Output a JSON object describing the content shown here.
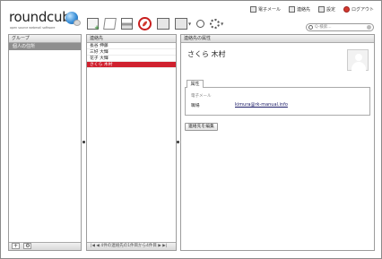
{
  "app": {
    "logo_text": "roundcube",
    "logo_tagline": "open source webmail software"
  },
  "topnav": {
    "mail": "電子メール",
    "contacts": "連絡先",
    "settings": "設定",
    "logout": "ログアウト"
  },
  "search": {
    "placeholder": "Q-検索..."
  },
  "groups": {
    "header": "グループ",
    "items": [
      {
        "label": "個人の住所",
        "selected": true
      }
    ]
  },
  "contacts": {
    "header": "連絡先",
    "rows": [
      {
        "name": "長谷 伸藤",
        "selected": false
      },
      {
        "name": "三好 大輝",
        "selected": false
      },
      {
        "name": "花子 大輝",
        "selected": false
      },
      {
        "name": "さくら 木村",
        "selected": true
      }
    ],
    "pager": "4件の連絡先の1件目から4件目"
  },
  "detail": {
    "header": "連絡先の属性",
    "name": "さくら 木村",
    "tab": "属性",
    "section_label": "電子メール",
    "field_label": "職場",
    "email": "kimura@rk-manual.info",
    "edit_button": "連絡先を編集"
  },
  "colors": {
    "accent": "#d0212f",
    "delete_highlight": "#c81e1e"
  }
}
